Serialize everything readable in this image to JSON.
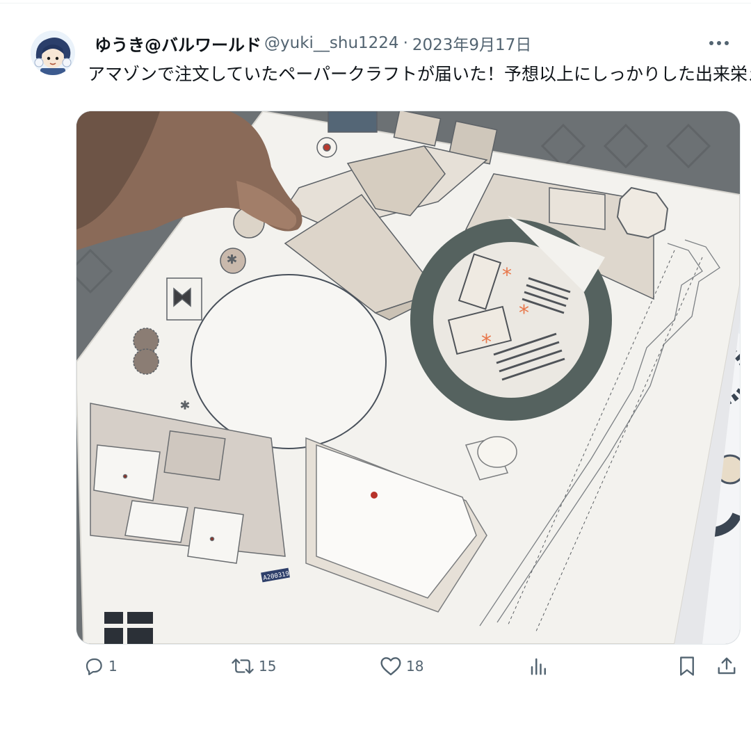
{
  "tweet": {
    "author": {
      "display_name": "ゆうき@バルワールド",
      "handle": "@yuki__shu1224"
    },
    "separator": "·",
    "date": "2023年9月17日",
    "text": "アマゾンで注文していたペーパークラフトが届いた！予想以上にしっかりした出来栄えw",
    "image": {
      "printed_code": "A200319"
    }
  },
  "actions": {
    "reply": {
      "icon": "reply-icon",
      "count": "1"
    },
    "retweet": {
      "icon": "retweet-icon",
      "count": "15"
    },
    "like": {
      "icon": "heart-icon",
      "count": "18"
    },
    "views": {
      "icon": "analytics-icon"
    },
    "bookmark": {
      "icon": "bookmark-icon"
    },
    "share": {
      "icon": "share-icon"
    }
  },
  "colors": {
    "text_primary": "#0f1419",
    "text_secondary": "#536471",
    "accent_orange": "#e8764a",
    "paper": "#f2f0ea",
    "part_beige": "#d9d0c4",
    "part_teal": "#55625f"
  }
}
